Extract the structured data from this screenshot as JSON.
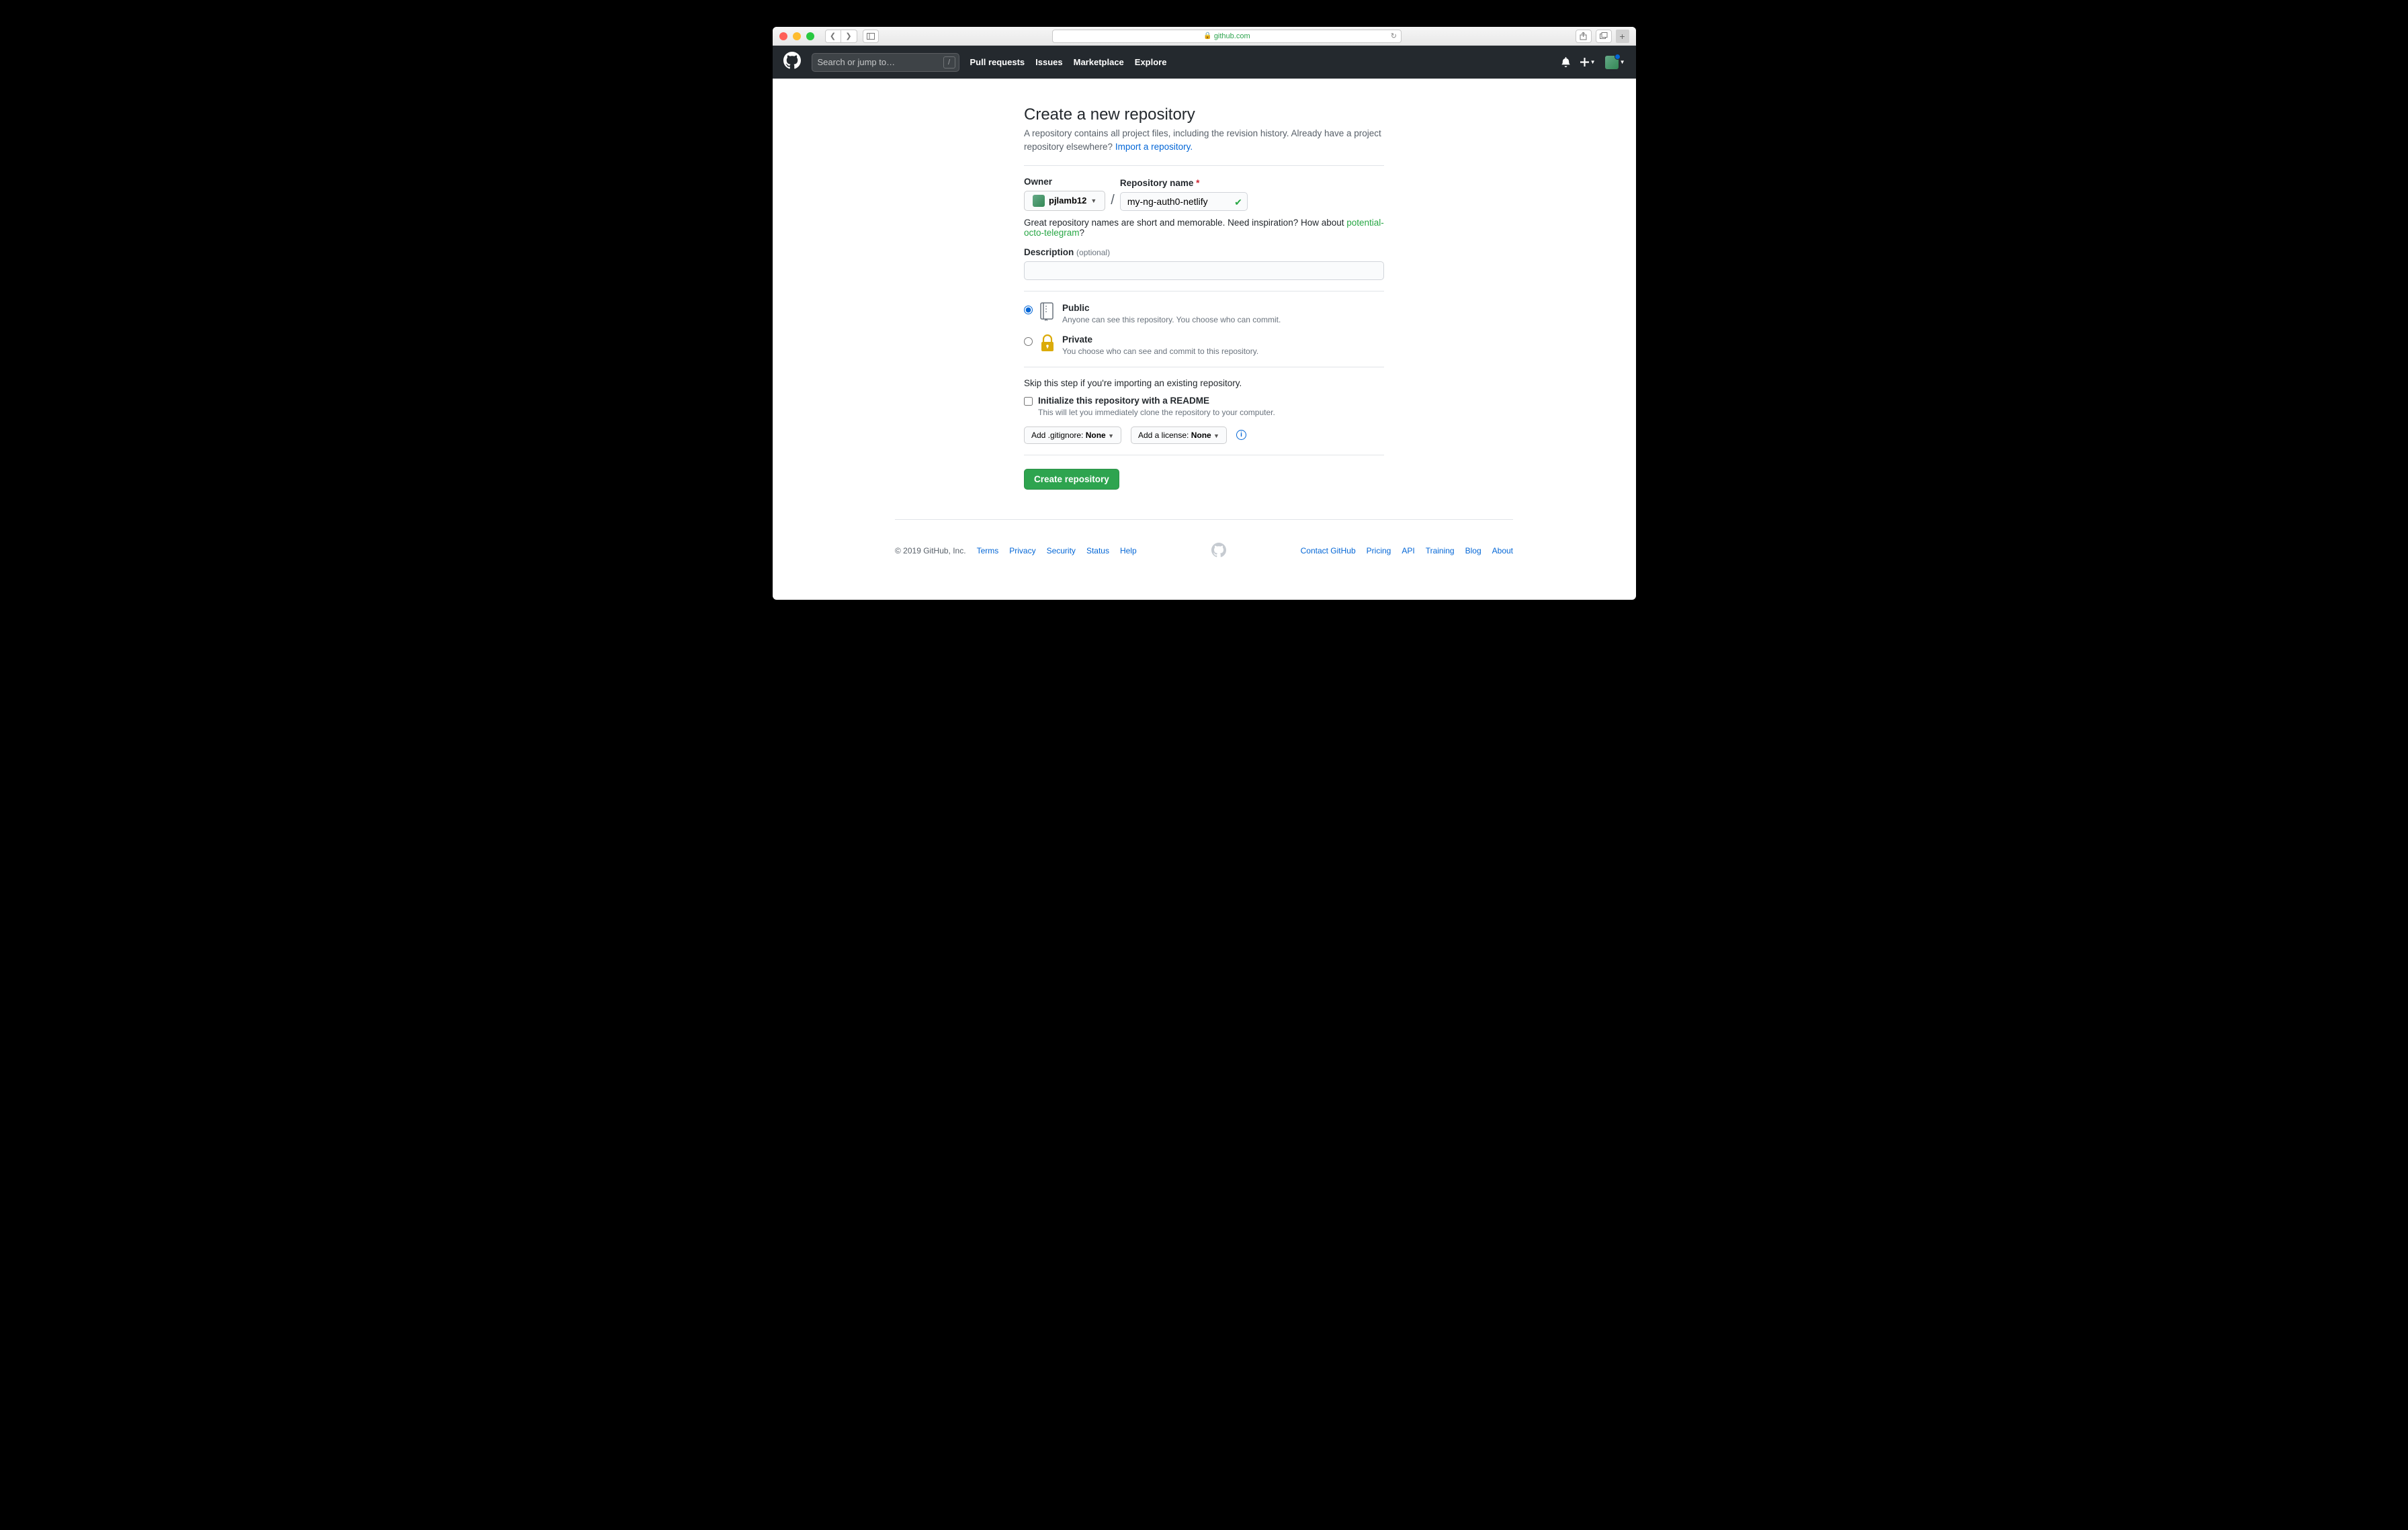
{
  "browser": {
    "url_host": "github.com"
  },
  "header": {
    "search_placeholder": "Search or jump to…",
    "nav": {
      "pulls": "Pull requests",
      "issues": "Issues",
      "marketplace": "Marketplace",
      "explore": "Explore"
    }
  },
  "page": {
    "title": "Create a new repository",
    "lead": "A repository contains all project files, including the revision history. Already have a project repository elsewhere? ",
    "import_link": "Import a repository.",
    "owner_label": "Owner",
    "owner_value": "pjlamb12",
    "repo_name_label": "Repository name",
    "repo_name_value": "my-ng-auth0-netlify",
    "name_hint_prefix": "Great repository names are short and memorable. Need inspiration? How about ",
    "name_hint_suggestion": "potential-octo-telegram",
    "name_hint_suffix": "?",
    "desc_label": "Description",
    "desc_optional": "(optional)",
    "desc_value": "",
    "visibility": {
      "public_label": "Public",
      "public_sub": "Anyone can see this repository. You choose who can commit.",
      "private_label": "Private",
      "private_sub": "You choose who can see and commit to this repository.",
      "selected": "public"
    },
    "skip_note": "Skip this step if you're importing an existing repository.",
    "readme_label": "Initialize this repository with a README",
    "readme_sub": "This will let you immediately clone the repository to your computer.",
    "gitignore_prefix": "Add .gitignore: ",
    "gitignore_value": "None",
    "license_prefix": "Add a license: ",
    "license_value": "None",
    "submit": "Create repository"
  },
  "footer": {
    "copyright": "© 2019 GitHub, Inc.",
    "left": {
      "terms": "Terms",
      "privacy": "Privacy",
      "security": "Security",
      "status": "Status",
      "help": "Help"
    },
    "right": {
      "contact": "Contact GitHub",
      "pricing": "Pricing",
      "api": "API",
      "training": "Training",
      "blog": "Blog",
      "about": "About"
    }
  }
}
